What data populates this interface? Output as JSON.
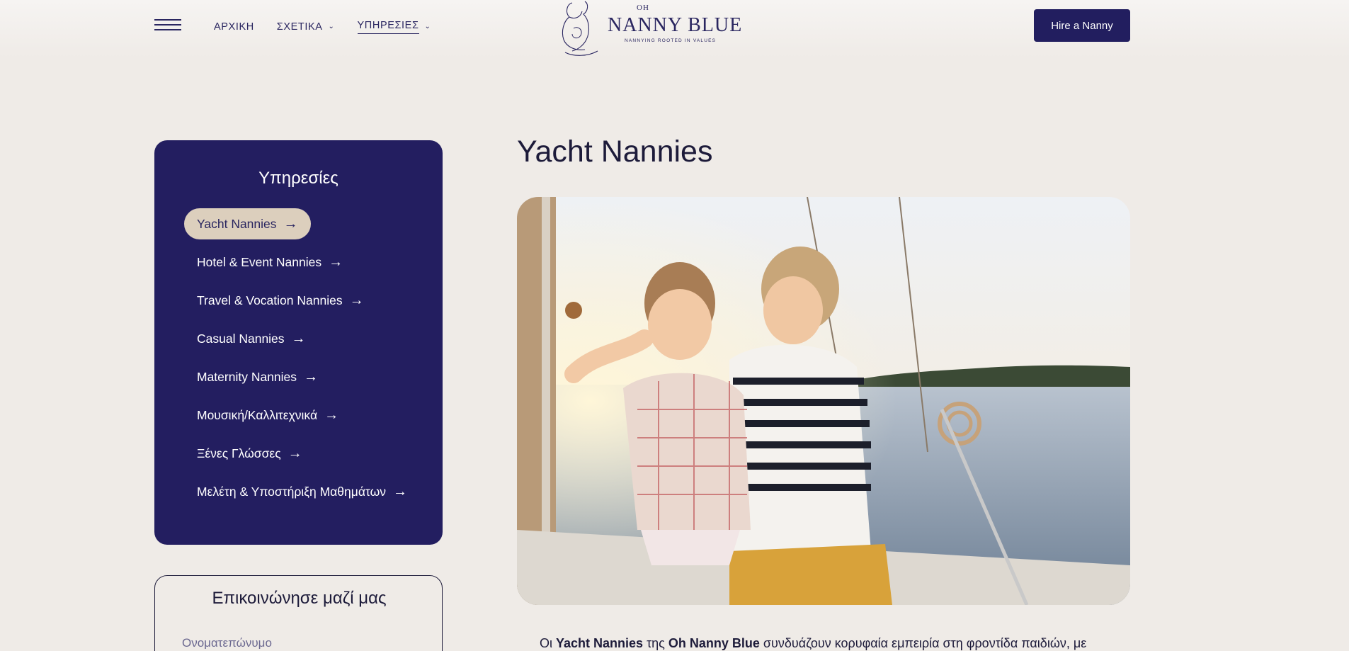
{
  "header": {
    "nav": [
      {
        "label": "ΑΡΧΙΚΗ",
        "dropdown": false,
        "active": false
      },
      {
        "label": "ΣΧΕΤΙΚΑ",
        "dropdown": true,
        "active": false
      },
      {
        "label": "ΥΠΗΡΕΣΙΕΣ",
        "dropdown": true,
        "active": true
      }
    ],
    "logo": {
      "small": "OH",
      "name": "NANNY BLUE",
      "tagline": "NANNYING ROOTED IN VALUES"
    },
    "cta": "Hire a Nanny"
  },
  "sidebar": {
    "title": "Υπηρεσίες",
    "items": [
      {
        "label": "Yacht Nannies",
        "active": true
      },
      {
        "label": "Hotel & Event Nannies",
        "active": false
      },
      {
        "label": "Travel & Vocation Nannies",
        "active": false
      },
      {
        "label": "Casual Nannies",
        "active": false
      },
      {
        "label": "Maternity Nannies",
        "active": false
      },
      {
        "label": "Μουσική/Καλλιτεχνικά",
        "active": false
      },
      {
        "label": "Ξένες Γλώσσες",
        "active": false
      },
      {
        "label": "Μελέτη & Υποστήριξη Μαθημάτων",
        "active": false
      }
    ],
    "arrow": "→"
  },
  "contact": {
    "title": "Επικοινώνησε μαζί μας",
    "name_placeholder": "Ονοματεπώνυμο"
  },
  "main": {
    "title": "Yacht Nannies",
    "intro": {
      "p1": "Οι ",
      "b1": "Yacht Nannies",
      "p2": " της ",
      "b2": "Oh Nanny Blue",
      "p3": " συνδυάζουν κορυφαία εμπειρία στη φροντίδα παιδιών, με"
    }
  },
  "colors": {
    "brand_navy": "#231e60",
    "active_pill": "#dccfbd",
    "page_bg": "#efebe7"
  }
}
